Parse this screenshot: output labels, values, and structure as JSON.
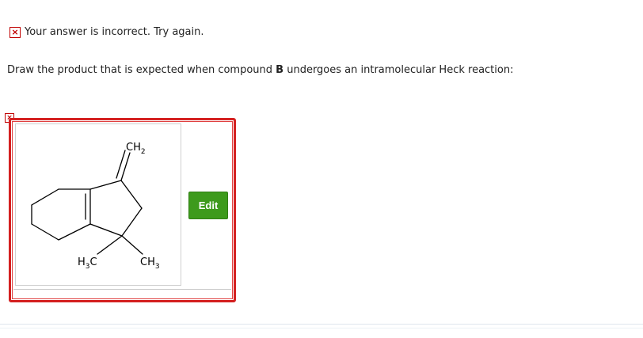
{
  "feedback": {
    "icon": "x-icon",
    "icon_glyph": "×",
    "text": "Your answer is incorrect.  Try again."
  },
  "question": {
    "text_before": "Draw the product that is expected when compound ",
    "compound": "B",
    "text_after": " undergoes an intramolecular Heck reaction:"
  },
  "answer": {
    "status_icon": "x-icon",
    "status_glyph": "×",
    "molecule": {
      "labels": {
        "ch2_main": "CH",
        "ch2_sub": "2",
        "h3c_h": "H",
        "h3c_sub": "3",
        "h3c_c": "C",
        "ch3_main": "CH",
        "ch3_sub": "3"
      }
    },
    "edit_label": "Edit"
  },
  "colors": {
    "error_red": "#d42020",
    "edit_green": "#3d9a1c"
  }
}
